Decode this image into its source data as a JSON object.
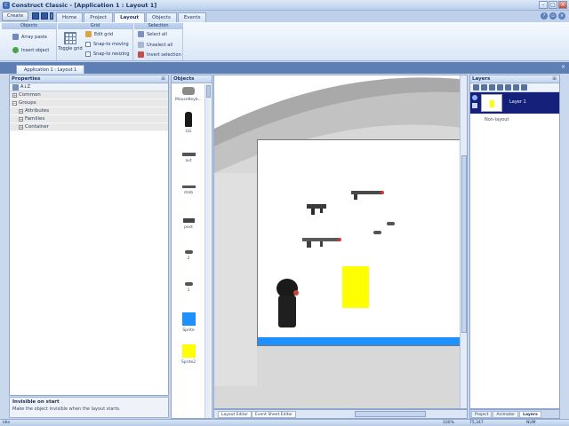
{
  "window": {
    "title": "Construct Classic - [Application 1 : Layout 1]",
    "app_icon_glyph": "C"
  },
  "ribbon": {
    "app_button": "Create",
    "tabs": [
      "Home",
      "Project",
      "Layout",
      "Objects",
      "Events"
    ],
    "active_tab": "Layout",
    "groups": {
      "objects": {
        "title": "Objects",
        "array_paste": "Array paste",
        "insert_object": "Insert object"
      },
      "grid": {
        "title": "Grid",
        "toggle_grid": "Toggle grid",
        "edit_grid": "Edit grid",
        "snap_moving": "Snap-to moving",
        "snap_resizing": "Snap-to resizing"
      },
      "selection": {
        "title": "Selection",
        "select_all": "Select all",
        "unselect_all": "Unselect all",
        "invert_selection": "Invert selection"
      }
    }
  },
  "document_tab": {
    "label": "Application 1 : Layout 1"
  },
  "properties": {
    "title": "Properties",
    "sort_label": "A↓Z",
    "rows": {
      "common": "Common",
      "groups": "Groups",
      "attributes": "Attributes",
      "families": "Families",
      "container": "Container"
    },
    "description_title": "Invisible on start",
    "description_text": "Make the object invisible when the layout starts."
  },
  "objects_panel": {
    "title": "Objects",
    "items": [
      {
        "label": "MouseKeyb..."
      },
      {
        "label": "GG"
      },
      {
        "label": "avt"
      },
      {
        "label": "drob"
      },
      {
        "label": "pest"
      },
      {
        "label": "2"
      },
      {
        "label": "1"
      },
      {
        "label": "Sprite"
      },
      {
        "label": "Sprite2"
      }
    ]
  },
  "editor": {
    "tabs": {
      "layout_editor": "Layout Editor",
      "event_sheet_editor": "Event Sheet Editor"
    },
    "colors": {
      "blue_sprite": "#1e90ff",
      "yellow_sprite": "#ffff00",
      "canvas": "#ffffff"
    }
  },
  "layers": {
    "title": "Layers",
    "layer_name": "Layer 1",
    "non_layout": "Non-layout"
  },
  "right_tabs": [
    "Project",
    "Animator",
    "Layers"
  ],
  "status": {
    "left": "Idle",
    "zoom": "100%",
    "coords": "75,347",
    "num": "NUM"
  }
}
